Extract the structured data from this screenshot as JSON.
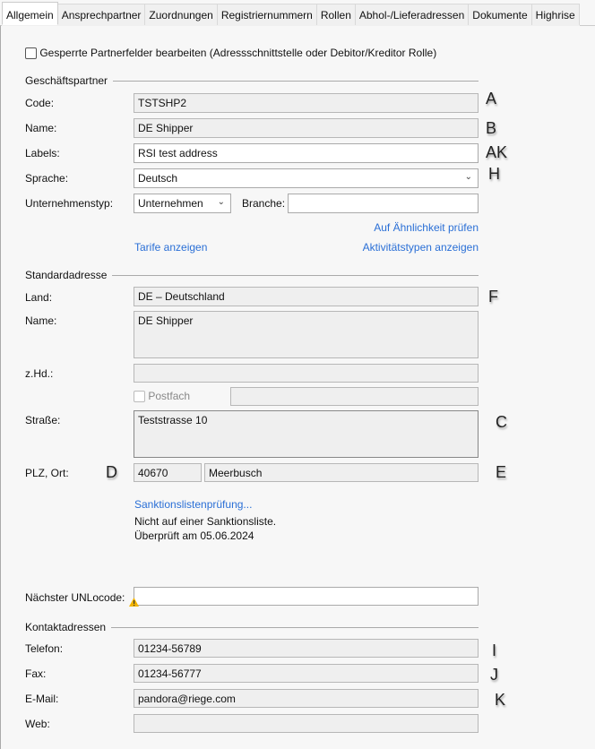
{
  "tabs": [
    "Allgemein",
    "Ansprechpartner",
    "Zuordnungen",
    "Registriernummern",
    "Rollen",
    "Abhol-/Lieferadressen",
    "Dokumente",
    "Highrise"
  ],
  "locked_checkbox": {
    "label": "Gesperrte Partnerfelder bearbeiten (Adressschnittstelle oder Debitor/Kreditor Rolle)",
    "checked": false
  },
  "partner": {
    "heading": "Geschäftspartner",
    "code_label": "Code:",
    "code": "TSTSHP2",
    "name_label": "Name:",
    "name": "DE Shipper",
    "labels_label": "Labels:",
    "labels": "RSI test address",
    "language_label": "Sprache:",
    "language": "Deutsch",
    "company_type_label": "Unternehmenstyp:",
    "company_type": "Unternehmen",
    "branch_label": "Branche:",
    "branch": "",
    "similarity_link": "Auf Ähnlichkeit prüfen",
    "tariffs_link": "Tarife anzeigen",
    "activity_link": "Aktivitätstypen anzeigen"
  },
  "address": {
    "heading": "Standardadresse",
    "country_label": "Land:",
    "country": "DE – Deutschland",
    "name_label": "Name:",
    "name": "DE Shipper",
    "attn_label": "z.Hd.:",
    "attn": "",
    "pobox_label": "Postfach",
    "pobox": "",
    "street_label": "Straße:",
    "street": "Teststrasse 10",
    "zip_city_label": "PLZ, Ort:",
    "zip": "40670",
    "city": "Meerbusch",
    "sanctions_link": "Sanktionslistenprüfung...",
    "sanctions_status": "Nicht auf einer Sanktionsliste.",
    "sanctions_checked": "Überprüft am 05.06.2024",
    "unlocode_label": "Nächster UNLocode:",
    "unlocode": ""
  },
  "contact": {
    "heading": "Kontaktadressen",
    "phone_label": "Telefon:",
    "phone": "01234-56789",
    "fax_label": "Fax:",
    "fax": "01234-56777",
    "email_label": "E-Mail:",
    "email": "pandora@riege.com",
    "web_label": "Web:",
    "web": ""
  },
  "markers": {
    "a": "A",
    "b": "B",
    "ak": "AK",
    "h": "H",
    "f": "F",
    "c": "C",
    "d": "D",
    "e": "E",
    "i": "I",
    "j": "J",
    "k": "K"
  },
  "colors": {
    "link": "#2a6fd6",
    "warning": "#f2b400"
  }
}
